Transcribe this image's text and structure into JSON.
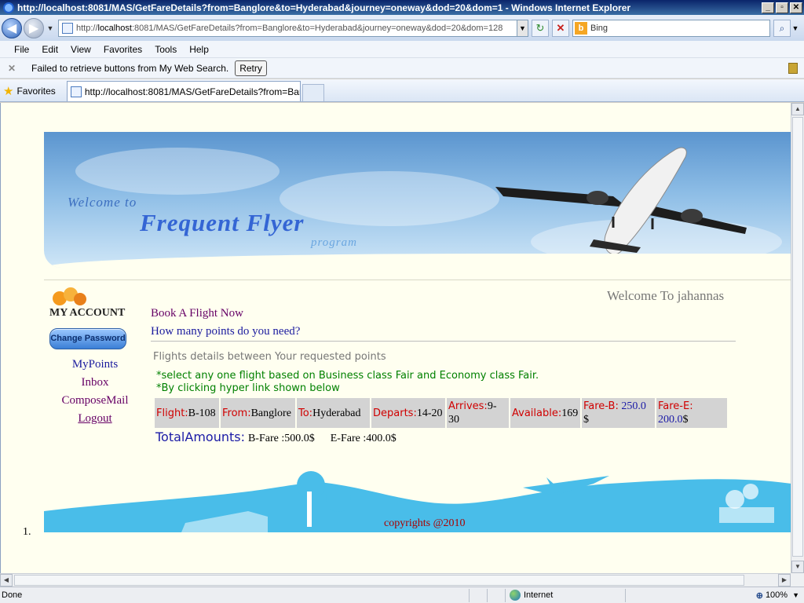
{
  "window": {
    "title": "http://localhost:8081/MAS/GetFareDetails?from=Banglore&to=Hyderabad&journey=oneway&dod=20&dom=1 - Windows Internet Explorer"
  },
  "address": {
    "prefix": "http://",
    "host": "localhost",
    "rest": ":8081/MAS/GetFareDetails?from=Banglore&to=Hyderabad&journey=oneway&dod=20&dom=128"
  },
  "search": {
    "placeholder": "Bing"
  },
  "menu": [
    "File",
    "Edit",
    "View",
    "Favorites",
    "Tools",
    "Help"
  ],
  "infobar": {
    "message": "Failed to retrieve buttons from My Web Search.",
    "retry": "Retry"
  },
  "favorites": {
    "label": "Favorites",
    "tab_title": "http://localhost:8081/MAS/GetFareDetails?from=Ban..."
  },
  "banner": {
    "welcome": "Welcome to",
    "brand": "Frequent Flyer",
    "program": "program"
  },
  "sidebar": {
    "account_label": "MY ACCOUNT",
    "change_password": "Change Password",
    "links": [
      "MyPoints",
      "Inbox",
      "ComposeMail",
      "Logout"
    ]
  },
  "main": {
    "welcome_user": "Welcome To jahannas",
    "book_link": "Book A Flight Now",
    "points_link": "How many points do you need?",
    "heading": "Flights details between Your requested points",
    "note1": "*select any one flight based on Business class Fair and Economy class Fair.",
    "note2": "*By clicking hyper link shown below"
  },
  "flight": {
    "flight_label": "Flight:",
    "flight_value": "B-108",
    "from_label": "From:",
    "from_value": "Banglore",
    "to_label": "To:",
    "to_value": "Hyderabad",
    "departs_label": "Departs:",
    "departs_value": "14-20",
    "arrives_label": "Arrives:",
    "arrives_value": "9-30",
    "available_label": "Available:",
    "available_value": "169",
    "fare_b_label": "Fare-B:",
    "fare_b_value": "250.0",
    "fare_b_unit": "$",
    "fare_e_label": "Fare-E:",
    "fare_e_value": "200.0",
    "fare_e_unit": "$"
  },
  "totals": {
    "label": "TotalAmounts:",
    "b_fare": "B-Fare :500.0$",
    "e_fare": "E-Fare :400.0$"
  },
  "footer": {
    "copyright": "copyrights @2010",
    "list_number": "1."
  },
  "status": {
    "left": "Done",
    "zone": "Internet",
    "zoom": "100%"
  }
}
